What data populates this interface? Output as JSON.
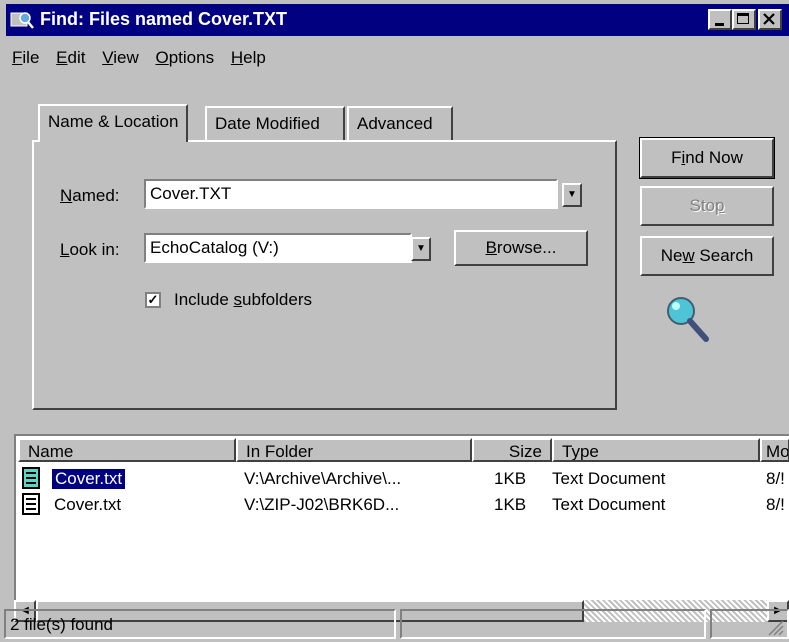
{
  "window": {
    "title": "Find: Files named Cover.TXT"
  },
  "menu": [
    {
      "pre": "",
      "u": "F",
      "post": "ile"
    },
    {
      "pre": "",
      "u": "E",
      "post": "dit"
    },
    {
      "pre": "",
      "u": "V",
      "post": "iew"
    },
    {
      "pre": "",
      "u": "O",
      "post": "ptions"
    },
    {
      "pre": "",
      "u": "H",
      "post": "elp"
    }
  ],
  "tabs": [
    "Name & Location",
    "Date Modified",
    "Advanced"
  ],
  "form": {
    "named_label_u": "N",
    "named_label_rest": "amed:",
    "named_value": "Cover.TXT",
    "lookin_label_u": "L",
    "lookin_label_rest": "ook in:",
    "lookin_value": "EchoCatalog (V:)",
    "browse_u": "B",
    "browse_rest": "rowse...",
    "include_pre": "Include ",
    "include_u": "s",
    "include_post": "ubfolders",
    "include_checked": true
  },
  "buttons": {
    "find_pre": "F",
    "find_u": "i",
    "find_post": "nd Now",
    "stop_pre": "Sto",
    "stop_u": "p",
    "stop_post": "",
    "new_pre": "Ne",
    "new_u": "w",
    "new_post": " Search"
  },
  "columns": [
    "Name",
    "In Folder",
    "Size",
    "Type",
    "Mo"
  ],
  "rows": [
    {
      "name": "Cover.txt",
      "folder": "V:\\Archive\\Archive\\...",
      "size": "1KB",
      "type": "Text Document",
      "modified": "8/!"
    },
    {
      "name": "Cover.txt",
      "folder": "V:\\ZIP-J02\\BRK6D...",
      "size": "1KB",
      "type": "Text Document",
      "modified": "8/!"
    }
  ],
  "status": {
    "text": "2 file(s) found"
  }
}
